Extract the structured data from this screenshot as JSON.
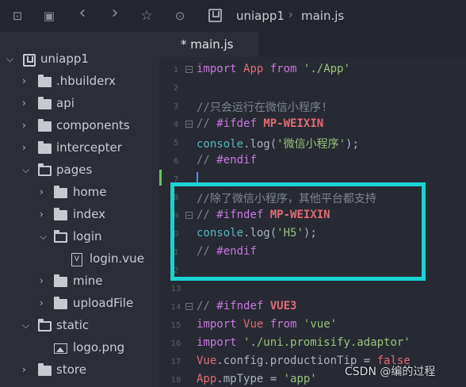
{
  "toolbar": {
    "buttons": [
      {
        "name": "new-file-icon",
        "glyph": "⊡"
      },
      {
        "name": "save-icon",
        "glyph": "▣"
      },
      {
        "name": "back-icon",
        "glyph": "‹"
      },
      {
        "name": "forward-icon",
        "glyph": "›"
      },
      {
        "name": "star-icon",
        "glyph": "☆"
      },
      {
        "name": "run-icon",
        "glyph": "⊙"
      }
    ],
    "breadcrumb": [
      "uniapp1",
      "main.js"
    ],
    "separator": "›"
  },
  "sidebar": {
    "project": "uniapp1",
    "items": [
      {
        "label": ".hbuilderx",
        "type": "folder",
        "state": "closed"
      },
      {
        "label": "api",
        "type": "folder",
        "state": "closed"
      },
      {
        "label": "components",
        "type": "folder",
        "state": "closed"
      },
      {
        "label": "intercepter",
        "type": "folder",
        "state": "closed"
      },
      {
        "label": "pages",
        "type": "folder",
        "state": "open"
      },
      {
        "label": "home",
        "type": "folder",
        "state": "closed"
      },
      {
        "label": "index",
        "type": "folder",
        "state": "closed"
      },
      {
        "label": "login",
        "type": "folder",
        "state": "open"
      },
      {
        "label": "login.vue",
        "type": "vue-file"
      },
      {
        "label": "mine",
        "type": "folder",
        "state": "closed"
      },
      {
        "label": "uploadFile",
        "type": "folder",
        "state": "closed"
      },
      {
        "label": "static",
        "type": "folder",
        "state": "open"
      },
      {
        "label": "logo.png",
        "type": "image-file"
      },
      {
        "label": "store",
        "type": "folder",
        "state": "closed"
      }
    ]
  },
  "editor": {
    "tab_label": "* main.js",
    "lines": [
      {
        "n": "1",
        "fold": true,
        "code": "import App from './App'"
      },
      {
        "n": "2",
        "code": ""
      },
      {
        "n": "3",
        "code": "//只会运行在微信小程序!"
      },
      {
        "n": "4",
        "fold": true,
        "code": "// #ifdef MP-WEIXIN"
      },
      {
        "n": "5",
        "code": "console.log('微信小程序');"
      },
      {
        "n": "6",
        "code": "// #endif"
      },
      {
        "n": "7",
        "code": ""
      },
      {
        "n": "8",
        "code": "//除了微信小程序，其他平台都支持"
      },
      {
        "n": "9",
        "fold": true,
        "code": "// #ifndef MP-WEIXIN"
      },
      {
        "n": "0",
        "code": "console.log('H5');"
      },
      {
        "n": "1",
        "code": "// #endif"
      },
      {
        "n": "2",
        "code": ""
      },
      {
        "n": "13",
        "code": ""
      },
      {
        "n": "14",
        "fold": true,
        "code": "// #ifndef VUE3"
      },
      {
        "n": "15",
        "code": "import Vue from 'vue'"
      },
      {
        "n": "16",
        "code": "import './uni.promisify.adaptor'"
      },
      {
        "n": "17",
        "code": "Vue.config.productionTip = false"
      },
      {
        "n": "18",
        "code": "App.mpType = 'app'"
      }
    ]
  },
  "watermark": "CSDN @编的过程",
  "colors": {
    "highlight_box": "#1cd2d2",
    "keyword": "#c678dd",
    "string": "#98c379",
    "comment": "#7f848e"
  }
}
